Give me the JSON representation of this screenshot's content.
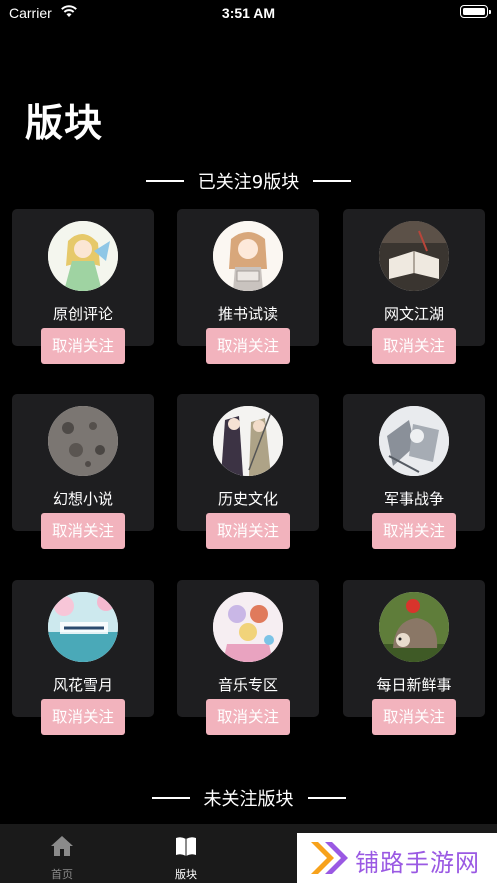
{
  "status_bar": {
    "carrier": "Carrier",
    "time": "3:51 AM"
  },
  "page": {
    "title": "版块"
  },
  "followed_section": {
    "title": "已关注9版块"
  },
  "unfollowed_section": {
    "title": "未关注版块"
  },
  "unfollow_label": "取消关注",
  "boards": [
    {
      "name": "原创评论",
      "image": "anime-girl-green-icon"
    },
    {
      "name": "推书试读",
      "image": "anime-girl-reading-icon"
    },
    {
      "name": "网文江湖",
      "image": "open-book-icon"
    },
    {
      "name": "幻想小说",
      "image": "moon-surface-icon"
    },
    {
      "name": "历史文化",
      "image": "anime-warriors-icon"
    },
    {
      "name": "军事战争",
      "image": "mecha-girl-icon"
    },
    {
      "name": "风花雪月",
      "image": "calligraphy-landscape-icon"
    },
    {
      "name": "音乐专区",
      "image": "anime-group-icon"
    },
    {
      "name": "每日新鲜事",
      "image": "hedgehog-apple-icon"
    }
  ],
  "tabbar": {
    "home_label": "首页",
    "board_label": "版块"
  },
  "watermark": {
    "text": "铺路手游网"
  },
  "colors": {
    "background": "#000000",
    "card": "#1e1e20",
    "unfollow_button": "#f2b3bd",
    "watermark_text": "#9a59e3"
  }
}
